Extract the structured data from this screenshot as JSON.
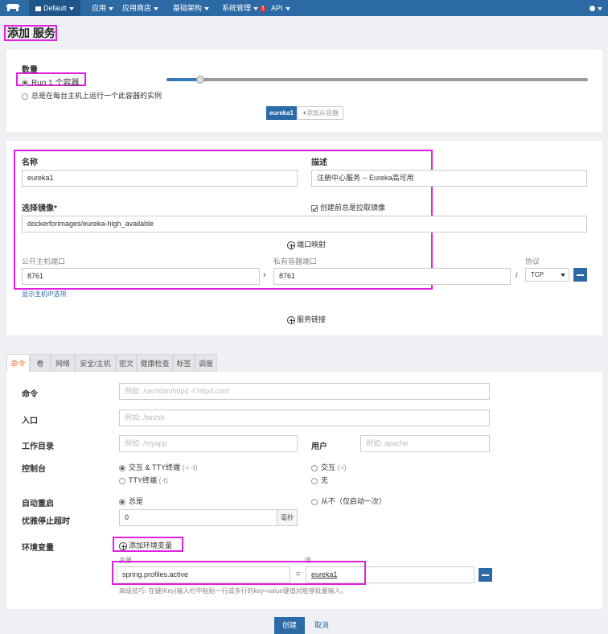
{
  "nav": {
    "env": "Default",
    "items": [
      "应用",
      "应用商店",
      "基础架构",
      "系统管理",
      "API"
    ],
    "warn_badge": "!"
  },
  "page_title": "添加 服务",
  "scale": {
    "label": "数量",
    "option_run": "Run 1 个容器",
    "option_global": "总是在每台主机上运行一个此容器的实例",
    "slider_fraction": 0.08,
    "container_tab": "eureka1",
    "add_sidekick": "添加从容器"
  },
  "form": {
    "name_label": "名称",
    "name_value": "eureka1",
    "desc_label": "描述",
    "desc_value": "注册中心服务 -- Eureka高可用",
    "image_label": "选择镜像*",
    "image_value": "dockerforimages/eureka-high_available",
    "pull_label": "创建前总是拉取镜像",
    "port_map": "端口映射",
    "public_port_label": "公开主机端口",
    "public_port_value": "8761",
    "private_port_label": "私有容器端口",
    "private_port_value": "8761",
    "protocol_label": "协议",
    "protocol_value": "TCP",
    "slash": "/",
    "show_host_ip": "显示主机IP选项",
    "service_link": "服务链接"
  },
  "tabs": [
    "命令",
    "卷",
    "网络",
    "安全/主机",
    "密文",
    "健康检查",
    "标签",
    "调度"
  ],
  "command": {
    "cmd_label": "命令",
    "cmd_placeholder": "例如: /usr/sbin/httpd -f httpd.conf",
    "entry_label": "入口",
    "entry_placeholder": "例如: /bin/sh",
    "workdir_label": "工作目录",
    "workdir_placeholder": "例如: /myapp",
    "user_label": "用户",
    "user_placeholder": "例如: apache",
    "console_label": "控制台",
    "console_opt1": "交互 & TTY终端",
    "console_opt1_hint": "(-i -t)",
    "console_opt2": "交互",
    "console_opt2_hint": "(-i)",
    "console_opt3": "TTY终端",
    "console_opt3_hint": "(-t)",
    "console_opt4": "无",
    "restart_label": "自动重启",
    "restart_always": "总是",
    "restart_never": "从不（仅启动一次）",
    "stop_label": "优雅停止超时",
    "stop_value": "0",
    "stop_unit": "毫秒",
    "env_label": "环境变量",
    "env_add": "添加环境变量",
    "env_var_label": "变量",
    "env_val_label": "值",
    "env_key": "spring.profiles.active",
    "env_eq": "=",
    "env_value": "eureka1",
    "env_tip": "高级技巧: 在键(Key)输入栏中粘贴一行或多行的key=value键值对能够批量输入。"
  },
  "footer": {
    "create": "创建",
    "cancel": "取消"
  }
}
